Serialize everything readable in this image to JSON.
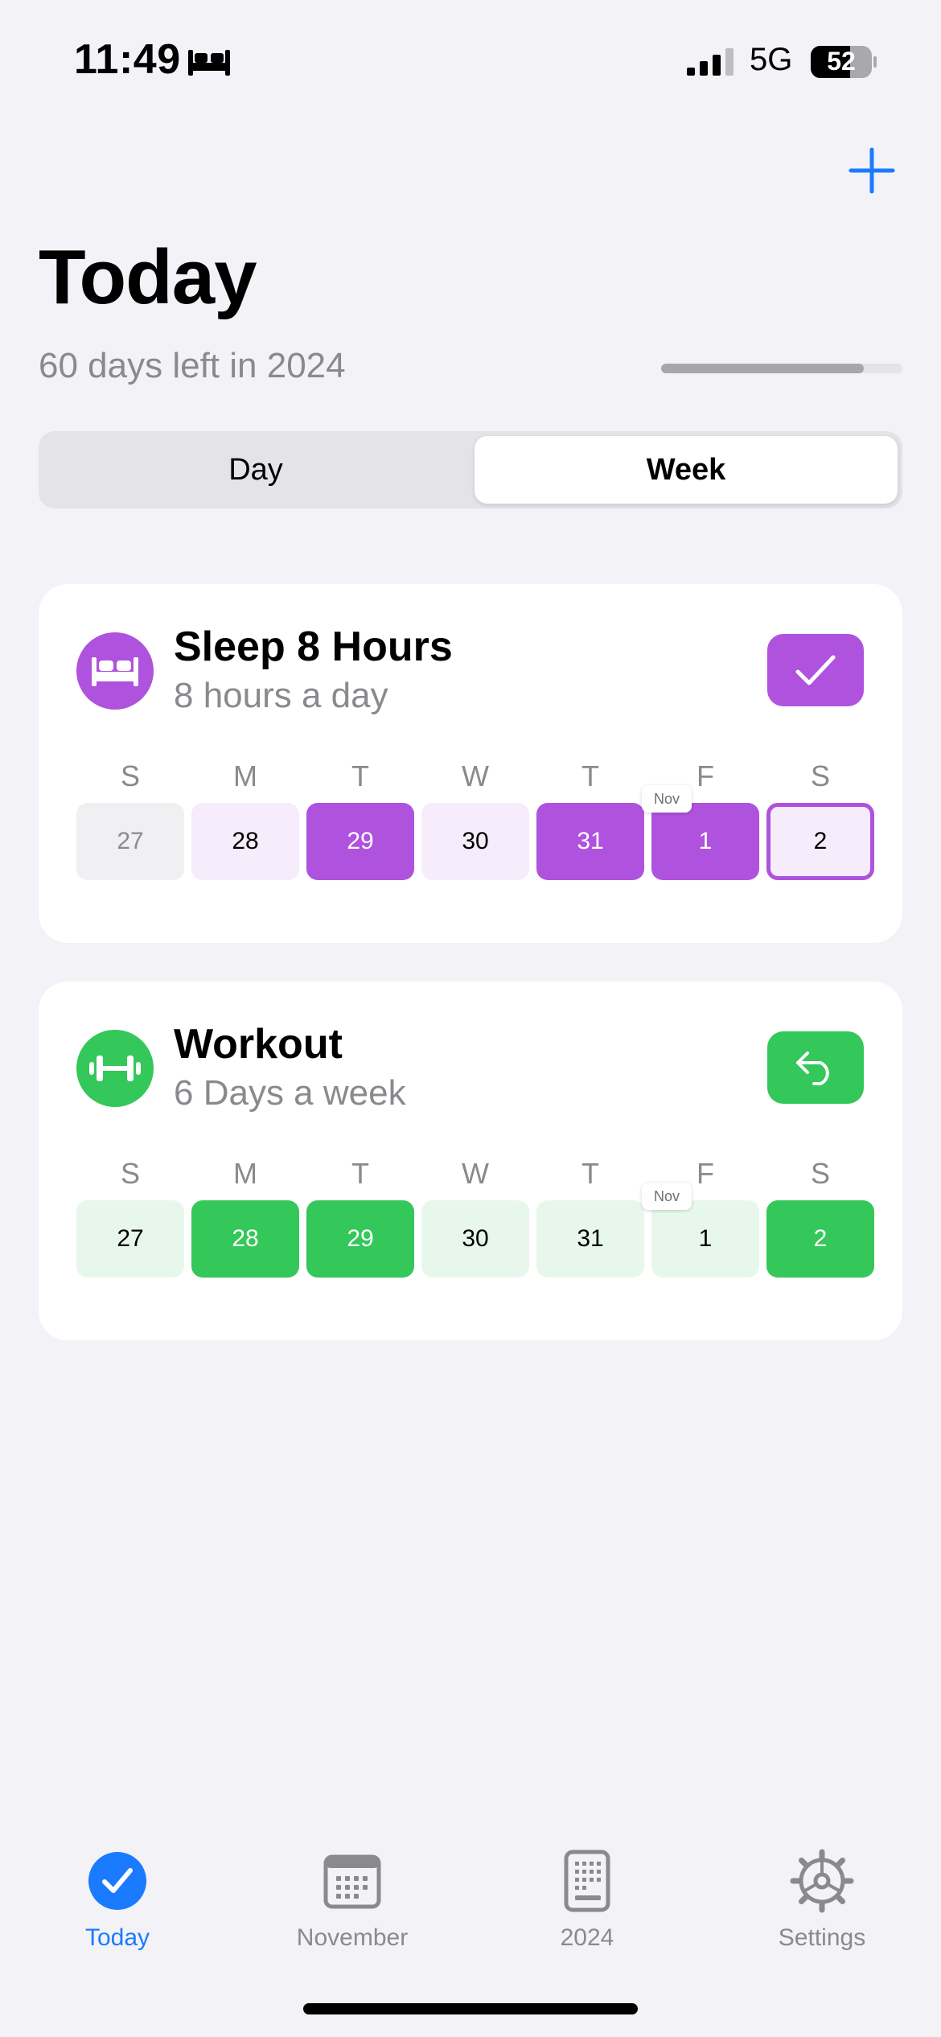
{
  "status_bar": {
    "time": "11:49",
    "network": "5G",
    "battery": "52"
  },
  "header": {
    "title": "Today",
    "subtitle": "60 days left in 2024",
    "year_progress_fraction": 0.84
  },
  "segmented": {
    "options": [
      "Day",
      "Week"
    ],
    "selected": "Week"
  },
  "weekday_labels": [
    "S",
    "M",
    "T",
    "W",
    "T",
    "F",
    "S"
  ],
  "habits": [
    {
      "title": "Sleep 8 Hours",
      "subtitle": "8 hours a day",
      "icon": "bed-icon",
      "color": "#AF52DE",
      "light_color": "#F6ECFB",
      "action_icon": "checkmark-icon",
      "month_marker": "Nov",
      "days": [
        {
          "label": "27",
          "state": "past-inactive"
        },
        {
          "label": "28",
          "state": "not-done"
        },
        {
          "label": "29",
          "state": "done"
        },
        {
          "label": "30",
          "state": "not-done"
        },
        {
          "label": "31",
          "state": "done"
        },
        {
          "label": "1",
          "state": "done"
        },
        {
          "label": "2",
          "state": "today"
        }
      ]
    },
    {
      "title": "Workout",
      "subtitle": "6 Days a week",
      "icon": "dumbbell-icon",
      "color": "#34C759",
      "light_color": "#E8F7EC",
      "action_icon": "undo-arrow-icon",
      "month_marker": "Nov",
      "days": [
        {
          "label": "27",
          "state": "not-done"
        },
        {
          "label": "28",
          "state": "done"
        },
        {
          "label": "29",
          "state": "done"
        },
        {
          "label": "30",
          "state": "not-done"
        },
        {
          "label": "31",
          "state": "not-done"
        },
        {
          "label": "1",
          "state": "not-done"
        },
        {
          "label": "2",
          "state": "done"
        }
      ]
    }
  ],
  "tabs": [
    {
      "label": "Today",
      "icon": "checkmark-circle-icon",
      "active": true
    },
    {
      "label": "November",
      "icon": "calendar-month-icon",
      "active": false
    },
    {
      "label": "2024",
      "icon": "calendar-year-icon",
      "active": false
    },
    {
      "label": "Settings",
      "icon": "gear-icon",
      "active": false
    }
  ],
  "colors": {
    "accent": "#1A7BFF",
    "background": "#F2F2F7"
  }
}
